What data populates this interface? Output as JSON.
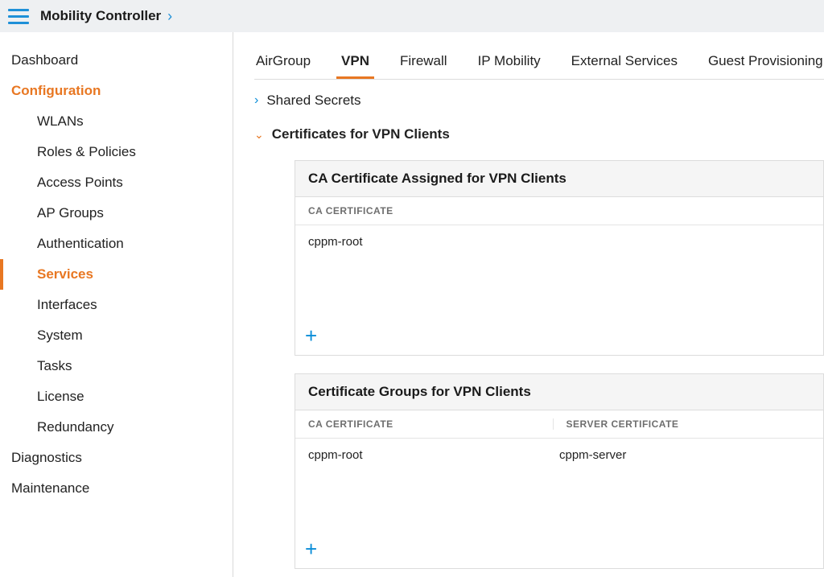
{
  "header": {
    "title": "Mobility Controller"
  },
  "sidebar": {
    "dashboard": "Dashboard",
    "configuration": "Configuration",
    "config_items": {
      "wlans": "WLANs",
      "roles": "Roles & Policies",
      "aps": "Access Points",
      "groups": "AP Groups",
      "auth": "Authentication",
      "services": "Services",
      "interfaces": "Interfaces",
      "system": "System",
      "tasks": "Tasks",
      "license": "License",
      "redundancy": "Redundancy"
    },
    "diagnostics": "Diagnostics",
    "maintenance": "Maintenance"
  },
  "tabs": {
    "airgroup": "AirGroup",
    "vpn": "VPN",
    "firewall": "Firewall",
    "ipmobility": "IP Mobility",
    "external": "External Services",
    "guest": "Guest Provisioning"
  },
  "sections": {
    "shared_secrets": "Shared Secrets",
    "certs_vpn": "Certificates for VPN Clients"
  },
  "card1": {
    "title": "CA Certificate Assigned for VPN Clients",
    "col1": "CA CERTIFICATE",
    "row1": "cppm-root"
  },
  "card2": {
    "title": "Certificate Groups for VPN Clients",
    "col1": "CA CERTIFICATE",
    "col2": "SERVER CERTIFICATE",
    "row1_col1": "cppm-root",
    "row1_col2": "cppm-server"
  }
}
